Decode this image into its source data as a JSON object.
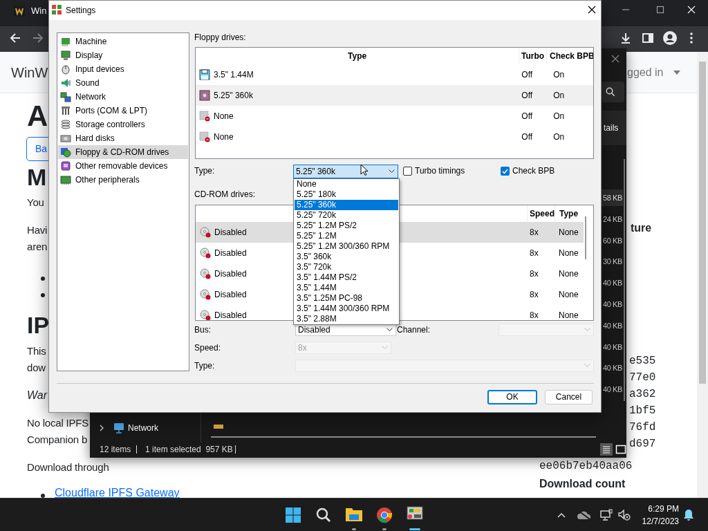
{
  "browser": {
    "tab_title": "Win",
    "site_name": "WinW",
    "account": "gged in",
    "left_column": [
      {
        "kind": "title",
        "text": "A"
      },
      {
        "kind": "button",
        "text": "Ba"
      },
      {
        "kind": "heading",
        "text": "M"
      },
      {
        "kind": "text",
        "text": "You"
      },
      {
        "kind": "text",
        "text": "Havi"
      },
      {
        "kind": "text",
        "text": "aren"
      },
      {
        "kind": "bullet"
      },
      {
        "kind": "bullet"
      },
      {
        "kind": "heading",
        "text": "IP"
      },
      {
        "kind": "text",
        "text": "This"
      },
      {
        "kind": "text",
        "text": "dow"
      },
      {
        "kind": "italic",
        "text": "War"
      },
      {
        "kind": "text",
        "text": "No local IPFS"
      },
      {
        "kind": "text",
        "text": "Companion b"
      },
      {
        "kind": "text",
        "text": "Download through"
      },
      {
        "kind": "link",
        "text": "Cloudflare IPFS Gateway"
      }
    ],
    "right_heading": "ture",
    "hashes": [
      "e535",
      "77e0",
      "a362",
      "1bf5",
      "76fd",
      "d697"
    ],
    "hash_full": "ee06b7eb40aa06",
    "download_heading": "Download count"
  },
  "explorer": {
    "details_button": "tails",
    "sizes": [
      {
        "text": "58 KB",
        "selected": true
      },
      {
        "text": "24 KB",
        "selected": false
      },
      {
        "text": "60 KB",
        "selected": false
      },
      {
        "text": "30 KB",
        "selected": false
      },
      {
        "text": "40 KB",
        "selected": false
      },
      {
        "text": "40 KB",
        "selected": false
      },
      {
        "text": "40 KB",
        "selected": false
      },
      {
        "text": "40 KB",
        "selected": false
      },
      {
        "text": "40 KB",
        "selected": false
      },
      {
        "text": "40 KB",
        "selected": false
      }
    ],
    "nav_item": "Network",
    "item_count": "12 items",
    "selection": "1 item selected  957 KB"
  },
  "dialog": {
    "title": "Settings",
    "sidebar": [
      {
        "label": "Machine",
        "selected": false
      },
      {
        "label": "Display",
        "selected": false
      },
      {
        "label": "Input devices",
        "selected": false
      },
      {
        "label": "Sound",
        "selected": false
      },
      {
        "label": "Network",
        "selected": false
      },
      {
        "label": "Ports (COM & LPT)",
        "selected": false
      },
      {
        "label": "Storage controllers",
        "selected": false
      },
      {
        "label": "Hard disks",
        "selected": false
      },
      {
        "label": "Floppy & CD-ROM drives",
        "selected": true
      },
      {
        "label": "Other removable devices",
        "selected": false
      },
      {
        "label": "Other peripherals",
        "selected": false
      }
    ],
    "floppy": {
      "label": "Floppy drives:",
      "columns": [
        "Type",
        "Turbo",
        "Check BPB"
      ],
      "rows": [
        {
          "kind": "floppy35",
          "type": "3.5\" 1.44M",
          "turbo": "Off",
          "check_bpb": "On",
          "selected": false
        },
        {
          "kind": "floppy525",
          "type": "5.25\" 360k",
          "turbo": "Off",
          "check_bpb": "On",
          "selected": true
        },
        {
          "kind": "empty",
          "type": "None",
          "turbo": "Off",
          "check_bpb": "On",
          "selected": false
        },
        {
          "kind": "empty",
          "type": "None",
          "turbo": "Off",
          "check_bpb": "On",
          "selected": false
        }
      ],
      "type_label": "Type:",
      "type_value": "5.25\" 360k",
      "turbo_timings": {
        "label": "Turbo timings",
        "checked": false
      },
      "check_bpb": {
        "label": "Check BPB",
        "checked": true
      },
      "type_options": [
        {
          "label": "None",
          "selected": false
        },
        {
          "label": "5.25\" 180k",
          "selected": false
        },
        {
          "label": "5.25\" 360k",
          "selected": true
        },
        {
          "label": "5.25\" 720k",
          "selected": false
        },
        {
          "label": "5.25\" 1.2M PS/2",
          "selected": false
        },
        {
          "label": "5.25\" 1.2M",
          "selected": false
        },
        {
          "label": "5.25\" 1.2M 300/360 RPM",
          "selected": false
        },
        {
          "label": "3.5\" 360k",
          "selected": false
        },
        {
          "label": "3.5\" 720k",
          "selected": false
        },
        {
          "label": "3.5\" 1.44M PS/2",
          "selected": false
        },
        {
          "label": "3.5\" 1.44M",
          "selected": false
        },
        {
          "label": "3.5\" 1.25M PC-98",
          "selected": false
        },
        {
          "label": "3.5\" 1.44M 300/360 RPM",
          "selected": false
        },
        {
          "label": "3.5\" 2.88M",
          "selected": false
        }
      ]
    },
    "cdrom": {
      "label": "CD-ROM drives:",
      "columns": [
        "Speed",
        "Type"
      ],
      "rows": [
        {
          "bus": "Disabled",
          "speed": "8x",
          "type": "None",
          "selected": true
        },
        {
          "bus": "Disabled",
          "speed": "8x",
          "type": "None",
          "selected": false
        },
        {
          "bus": "Disabled",
          "speed": "8x",
          "type": "None",
          "selected": false
        },
        {
          "bus": "Disabled",
          "speed": "8x",
          "type": "None",
          "selected": false
        },
        {
          "bus": "Disabled",
          "speed": "8x",
          "type": "None",
          "selected": false
        }
      ],
      "bus_label": "Bus:",
      "bus_value": "Disabled",
      "channel_label": "Channel:",
      "speed_label": "Speed:",
      "speed_value": "8x",
      "type_label": "Type:"
    },
    "buttons": [
      "OK",
      "Cancel"
    ]
  },
  "taskbar": {
    "time": "6:29 PM",
    "date": "12/7/2023"
  }
}
